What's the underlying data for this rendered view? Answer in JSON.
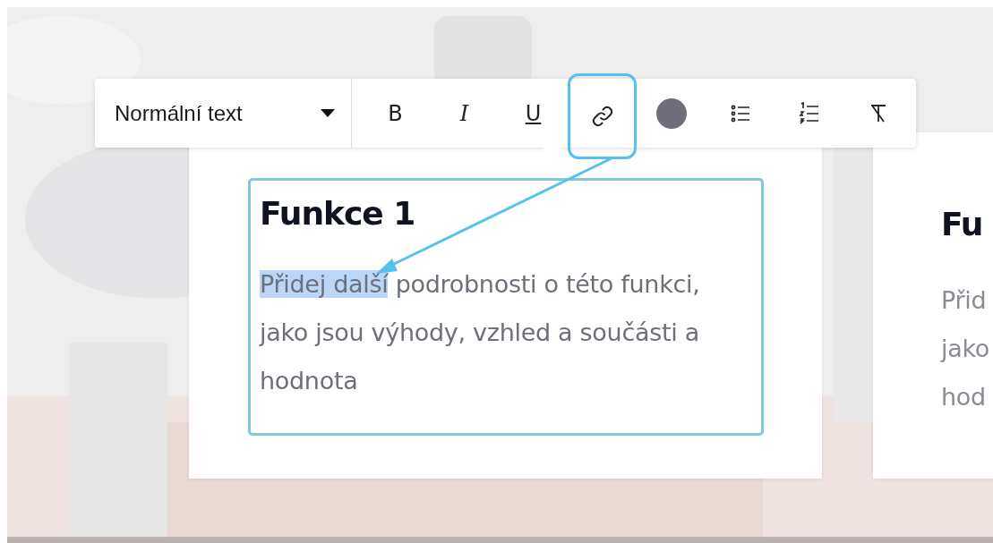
{
  "toolbar": {
    "block_style": "Normální text",
    "tools": [
      {
        "kind": "bold",
        "label": "B",
        "highlighted": false
      },
      {
        "kind": "italic",
        "label": "I",
        "highlighted": false
      },
      {
        "kind": "underline",
        "label": "U",
        "highlighted": false
      },
      {
        "kind": "link",
        "highlighted": true
      },
      {
        "kind": "color",
        "color": "#6e6f7a",
        "highlighted": false
      },
      {
        "kind": "bullets",
        "highlighted": false
      },
      {
        "kind": "numbers",
        "highlighted": false
      },
      {
        "kind": "clear",
        "highlighted": false
      }
    ]
  },
  "cards": [
    {
      "heading": "Funkce 1",
      "editing": true,
      "paragraph": {
        "highlighted": "Přidej další",
        "text": " podrobnosti o této funkci, jako jsou výhody, vzhled a součásti a hodnota"
      }
    },
    {
      "heading": "Fu",
      "editing": false,
      "lines": [
        "Přid",
        "jako",
        "hod"
      ]
    }
  ],
  "annotation": {
    "arrow": true
  }
}
